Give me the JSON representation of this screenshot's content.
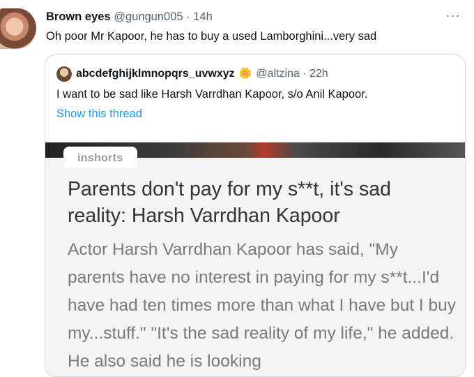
{
  "tweet": {
    "author_name": "Brown eyes",
    "handle_time": "@gungun005 · 14h",
    "more_label": "···",
    "text": "Oh poor Mr Kapoor, he has to buy a used Lamborghini...very sad"
  },
  "quoted_tweet": {
    "author_name": "abcdefghijklmnopqrs_uvwxyz",
    "emoji": "🌼",
    "handle_time": "@altzina · 22h",
    "text": "I want to be sad like Harsh Varrdhan Kapoor, s/o Anil Kapoor.",
    "show_thread": "Show this thread"
  },
  "media": {
    "brand": "inshorts",
    "headline": "Parents don't pay for my s**t, it's sad reality: Harsh Varrdhan Kapoor",
    "body": "Actor Harsh Varrdhan Kapoor has said, \"My parents have no interest in paying for my s**t...I'd have had ten times more than what I have but I buy my...stuff.\" \"It's the sad reality of my life,\" he added. He also said he is looking"
  },
  "colors": {
    "link": "#1d9bf0",
    "secondary_text": "#536471",
    "border": "#cfd9de"
  },
  "icons": {
    "more": "more-horizontal-icon",
    "emoji": "flower-emoji-icon"
  }
}
